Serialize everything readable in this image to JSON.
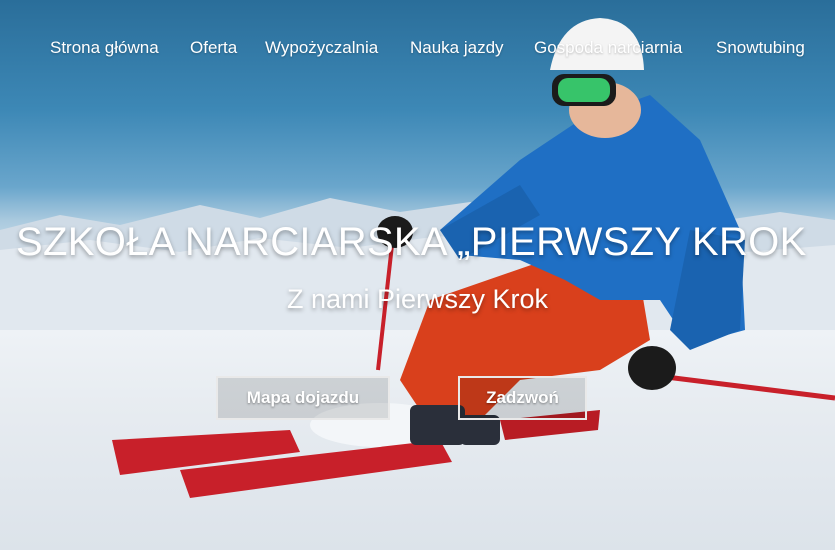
{
  "nav": {
    "items": [
      {
        "label": "Strona główna"
      },
      {
        "label": "Oferta"
      },
      {
        "label": "Wypożyczalnia"
      },
      {
        "label": "Nauka jazdy"
      },
      {
        "label": "Gospoda narciarnia"
      },
      {
        "label": "Snowtubing"
      }
    ]
  },
  "hero": {
    "title": "SZKOŁA NARCIARSKA „PIERWSZY KROK",
    "subtitle": "Z nami Pierwszy Krok",
    "buttons": {
      "map_label": "Mapa dojazdu",
      "call_label": "Zadzwoń"
    }
  },
  "colors": {
    "sky": "#2a6e9a",
    "jacket": "#1f6fc4",
    "pants": "#d9401c",
    "skis": "#c8202a",
    "goggles": "#37c46a"
  }
}
